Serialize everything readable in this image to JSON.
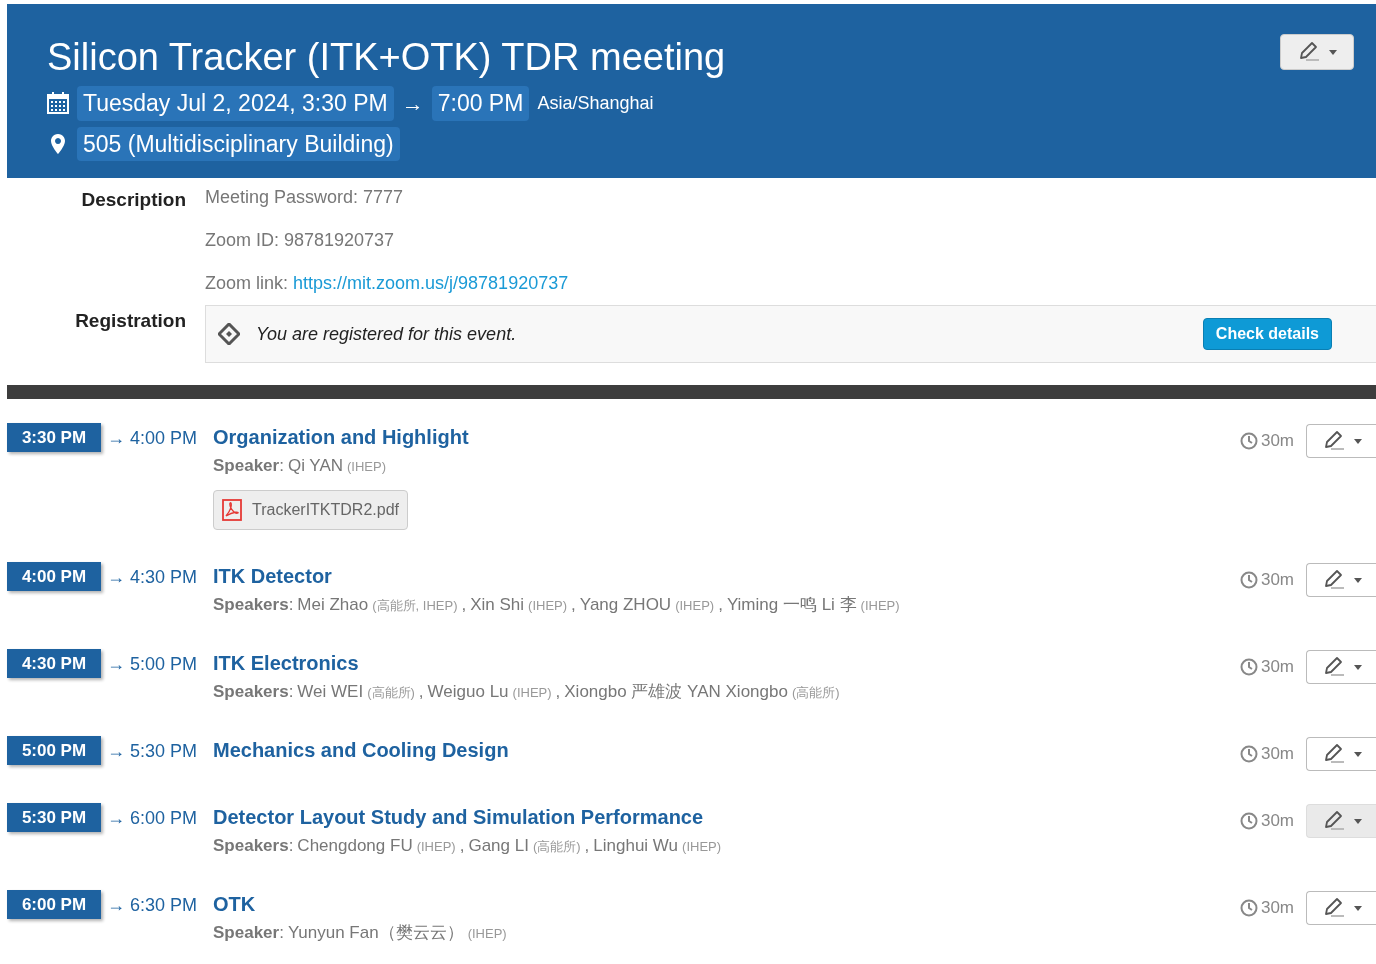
{
  "header": {
    "title": "Silicon Tracker (ITK+OTK) TDR meeting",
    "start": "Tuesday Jul 2, 2024, 3:30 PM",
    "arrow": "→",
    "end": "7:00 PM",
    "timezone": "Asia/Shanghai",
    "location": "505 (Multidisciplinary Building)"
  },
  "description": {
    "label": "Description",
    "lines": [
      {
        "text": "Meeting Password: 7777"
      },
      {
        "text": "Zoom ID: 98781920737"
      },
      {
        "text": "Zoom link: ",
        "link": "https://mit.zoom.us/j/98781920737"
      }
    ]
  },
  "registration": {
    "label": "Registration",
    "message": "You are registered for this event.",
    "button": "Check details"
  },
  "timetable": [
    {
      "start": "3:30 PM",
      "end": "→ 4:00 PM",
      "title": "Organization and Highlight",
      "speaker_label": "Speaker",
      "colon": ":",
      "speakers": [
        {
          "name": "Qi YAN",
          "affiliation": "(IHEP)"
        }
      ],
      "attachments": [
        "TrackerITKTDR2.pdf"
      ],
      "duration": "30m",
      "highlighted": false
    },
    {
      "start": "4:00 PM",
      "end": "→ 4:30 PM",
      "title": "ITK Detector",
      "speaker_label": "Speakers",
      "colon": ":",
      "separator": ",",
      "speakers": [
        {
          "name": "Mei Zhao",
          "affiliation": "(高能所, IHEP)"
        },
        {
          "name": "Xin Shi",
          "affiliation": "(IHEP)"
        },
        {
          "name": "Yang ZHOU",
          "affiliation": "(IHEP)"
        },
        {
          "name": "Yiming 一鸣 Li 李",
          "affiliation": "(IHEP)"
        }
      ],
      "duration": "30m",
      "highlighted": false
    },
    {
      "start": "4:30 PM",
      "end": "→ 5:00 PM",
      "title": "ITK Electronics",
      "speaker_label": "Speakers",
      "colon": ":",
      "separator": ",",
      "speakers": [
        {
          "name": "Wei WEI",
          "affiliation": "(高能所)"
        },
        {
          "name": "Weiguo Lu",
          "affiliation": "(IHEP)"
        },
        {
          "name": "Xiongbo 严雄波 YAN Xiongbo",
          "affiliation": "(高能所)"
        }
      ],
      "duration": "30m",
      "highlighted": false
    },
    {
      "start": "5:00 PM",
      "end": "→ 5:30 PM",
      "title": "Mechanics and Cooling Design",
      "duration": "30m",
      "highlighted": false
    },
    {
      "start": "5:30 PM",
      "end": "→ 6:00 PM",
      "title": "Detector Layout Study and Simulation Performance",
      "speaker_label": "Speakers",
      "colon": ":",
      "separator": ",",
      "speakers": [
        {
          "name": "Chengdong FU",
          "affiliation": "(IHEP)"
        },
        {
          "name": "Gang LI",
          "affiliation": "(高能所)"
        },
        {
          "name": "Linghui Wu",
          "affiliation": "(IHEP)"
        }
      ],
      "duration": "30m",
      "highlighted": true
    },
    {
      "start": "6:00 PM",
      "end": "→ 6:30 PM",
      "title": "OTK",
      "speaker_label": "Speaker",
      "colon": ":",
      "speakers": [
        {
          "name": "Yunyun Fan（樊云云）",
          "affiliation": "(IHEP)"
        }
      ],
      "duration": "30m",
      "highlighted": false
    }
  ]
}
